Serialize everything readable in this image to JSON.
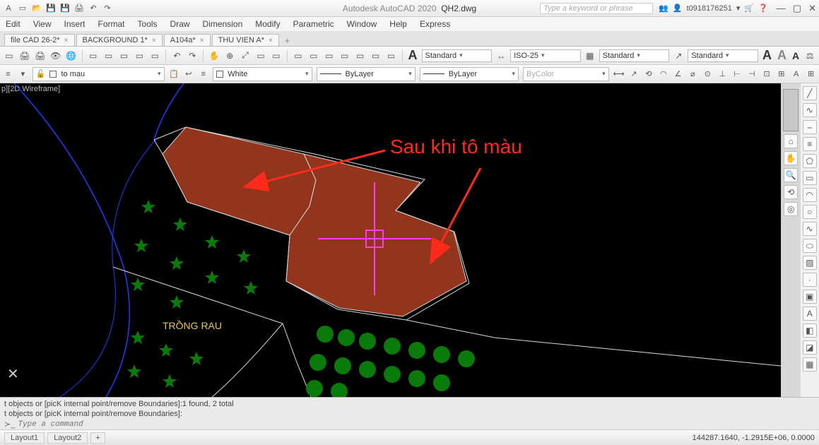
{
  "title": {
    "app": "Autodesk AutoCAD 2020",
    "file": "QH2.dwg"
  },
  "search_placeholder": "Type a keyword or phrase",
  "user": {
    "name": "t0918176251"
  },
  "menu": {
    "edit": "Edit",
    "view": "View",
    "insert": "Insert",
    "format": "Format",
    "tools": "Tools",
    "draw": "Draw",
    "dimension": "Dimension",
    "modify": "Modify",
    "parametric": "Parametric",
    "window": "Window",
    "help": "Help",
    "express": "Express"
  },
  "tabs": [
    {
      "label": "file CAD 26-2*"
    },
    {
      "label": "BACKGROUND 1*"
    },
    {
      "label": "A104a*"
    },
    {
      "label": "THU VIEN A*"
    }
  ],
  "text_styles": {
    "s1": "Standard",
    "dim": "ISO-25",
    "s2": "Standard",
    "s3": "Standard"
  },
  "prop": {
    "layer": "to mau",
    "color": "White",
    "ltype": "ByLayer",
    "lweight": "ByLayer",
    "plot": "ByColor"
  },
  "visual_style": "p][2D Wireframe]",
  "annotation": "Sau khi tô màu",
  "label_trongrau": "TRỒNG RAU",
  "cmd": {
    "line1": "t objects or [picK internal point/remove Boundaries]:1 found, 2 total",
    "line2": "t objects or [picK internal point/remove Boundaries]:",
    "prompt": "Type a command"
  },
  "layouts": {
    "l1": "Layout1",
    "l2": "Layout2"
  },
  "coords": "144287.1640, -1.2915E+06, 0.0000"
}
